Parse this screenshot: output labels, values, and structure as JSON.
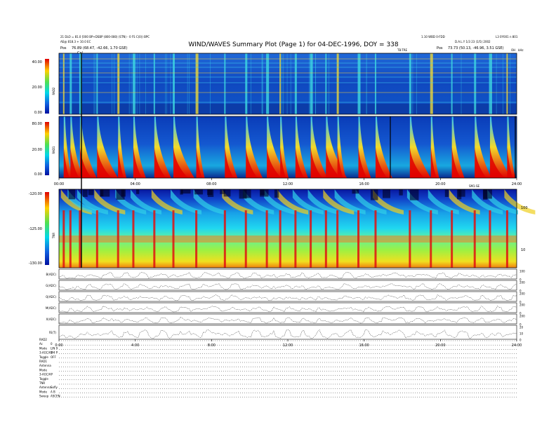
{
  "header": {
    "title": "WIND/WAVES Summary Plot (Page 1) for 04-DEC-1996, DOY = 338",
    "left_line1": "21 DLO = 81.0 [000 BP+DSBP (800-080) (STN) - 0 FS C(0)) BPC",
    "left_line2": "AE@ 818.3 + 10.0 EC",
    "left_line3": "Pos",
    "left_pos": "76.89 (68.47, -42.66, 1.70 GSE)",
    "right_top_left": "1.10 WBD 0-FDD",
    "right_top_right": "L3 0Y001 n 801",
    "right_line2": "D.A.L.Y 1/3 23 (1/5) 2002",
    "right_line3": "Pos",
    "right_pos": "73.73 (50.13, -46.96, 3.51 GSE)",
    "marker": "Cal",
    "sub_label": "TB-TRE",
    "unit_right": "kHz",
    "oh_label": "OH"
  },
  "chart_data": [
    {
      "type": "heatmap",
      "panel": "RAD2",
      "ylabel": "RAD2",
      "yticks": [
        "40.00",
        "20.00",
        "0.00"
      ],
      "colorbar": "red-yellow-green-cyan-blue",
      "bursts_hours": [
        0.25,
        0.6,
        1.1,
        2.0,
        3.1,
        3.9,
        5.0,
        6.0,
        7.2,
        8.7,
        9.8,
        10.9,
        11.6,
        12.4,
        13.2,
        14.0,
        14.6,
        15.7,
        16.6,
        18.4,
        19.5,
        20.6,
        21.8,
        22.6,
        23.5
      ]
    },
    {
      "type": "heatmap",
      "panel": "RAD1",
      "ylabel": "RAD1",
      "yticks": [
        "80.00",
        "20.00",
        "0.00"
      ],
      "xticks": [
        "00:00",
        "04:00",
        "08:00",
        "12:00",
        "16:00",
        "20:00",
        "24:00"
      ],
      "xlim": [
        0,
        24
      ],
      "xlabel_right": "SM1-SE"
    },
    {
      "type": "heatmap",
      "panel": "TNR",
      "ylabel": "TNR",
      "yticks": [
        "-120.00",
        "-125.00",
        "-130.00"
      ],
      "right_ticks": [
        "100",
        "10"
      ]
    },
    {
      "type": "line",
      "panels": [
        {
          "label": "B(ADC)",
          "right_ticks": [
            "100",
            "0"
          ]
        },
        {
          "label": "G(ADC)",
          "right_ticks": [
            "200",
            "0"
          ]
        },
        {
          "label": "Q(ADC)",
          "right_ticks": [
            "200",
            "0"
          ]
        },
        {
          "label": "M(ADC)",
          "right_ticks": [
            "200",
            "0"
          ]
        },
        {
          "label": "X(ADC)",
          "right_ticks": [
            "200",
            "0"
          ]
        },
        {
          "label": "FE(T)",
          "right_ticks": [
            "20",
            "10",
            "0"
          ]
        }
      ],
      "xticks": [
        "0:00",
        "4:00",
        "8:00",
        "12:00",
        "16:00",
        "20:00",
        "24:00"
      ]
    }
  ],
  "status_rows": [
    {
      "k": "RAD2",
      "v": ""
    },
    {
      "k": "Ac",
      "v": "0"
    },
    {
      "k": "Mode",
      "v": "LIN 9"
    },
    {
      "k": "3-AGC/AP",
      "v": "3/4 P"
    },
    {
      "k": "Toggle",
      "v": "OFF"
    },
    {
      "k": "RAD1",
      "v": ""
    },
    {
      "k": "Antenna",
      "v": ""
    },
    {
      "k": "Mode",
      "v": ""
    },
    {
      "k": "3-AGC/AP",
      "v": ""
    },
    {
      "k": "Toggle",
      "v": ""
    },
    {
      "k": "TNR",
      "v": ""
    },
    {
      "k": "Antenna",
      "v": "Sofly"
    },
    {
      "k": "Mode",
      "v": "A B"
    },
    {
      "k": "Sweep",
      "v": "ASCEN"
    }
  ]
}
